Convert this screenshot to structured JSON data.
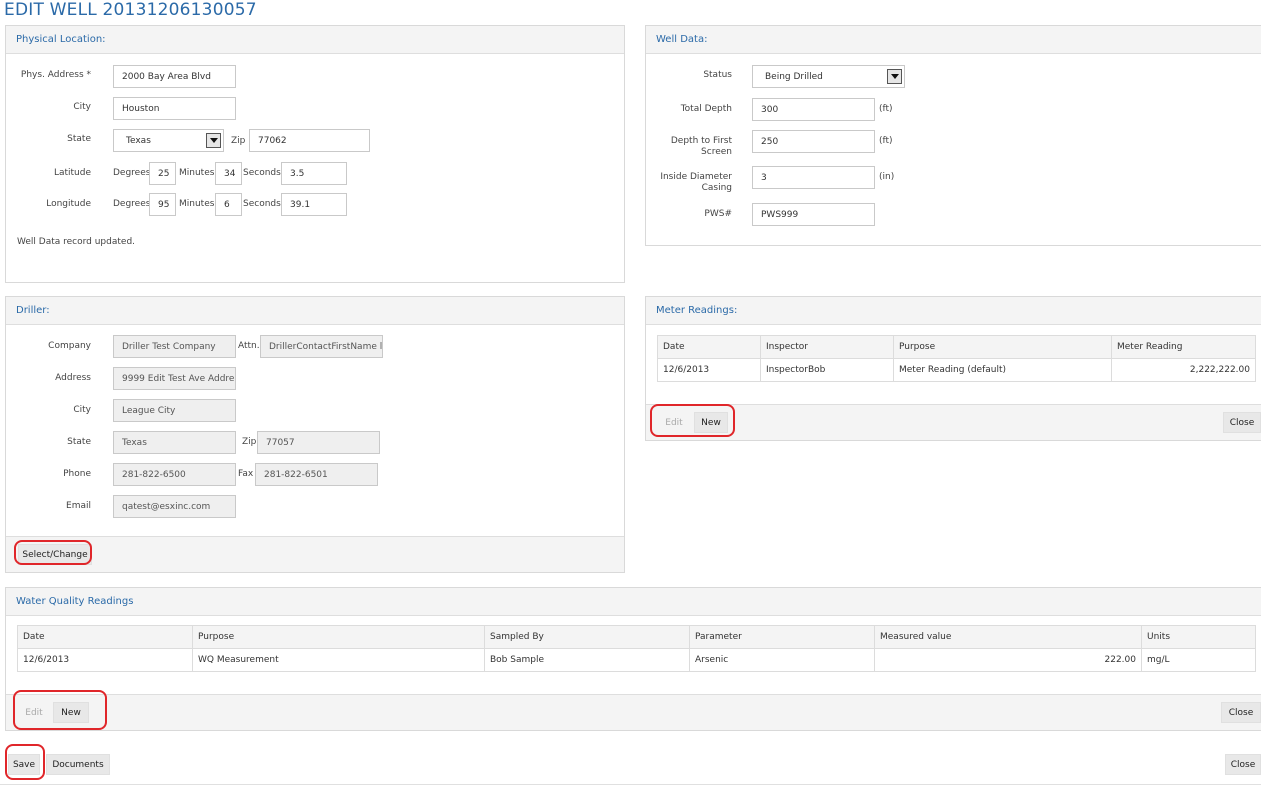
{
  "page": {
    "title": "EDIT WELL 20131206130057"
  },
  "physical_location": {
    "title": "Physical Location:",
    "address_label": "Phys. Address *",
    "address": "2000 Bay Area Blvd",
    "city_label": "City",
    "city": "Houston",
    "state_label": "State",
    "state": "Texas",
    "zip_label": "Zip",
    "zip": "77062",
    "latitude_label": "Latitude",
    "longitude_label": "Longitude",
    "degrees_label": "Degrees",
    "minutes_label": "Minutes",
    "seconds_label": "Seconds",
    "lat_degrees": "25",
    "lat_minutes": "34",
    "lat_seconds": "3.5",
    "lon_degrees": "95",
    "lon_minutes": "6",
    "lon_seconds": "39.1",
    "status_message": "Well Data record updated."
  },
  "well_data": {
    "title": "Well Data:",
    "status_label": "Status",
    "status": "Being Drilled",
    "total_depth_label": "Total Depth",
    "total_depth": "300",
    "total_depth_unit": "(ft)",
    "depth_first_screen_label_1": "Depth to First",
    "depth_first_screen_label_2": "Screen",
    "depth_first_screen": "250",
    "depth_first_screen_unit": "(ft)",
    "inside_diameter_label_1": "Inside Diameter",
    "inside_diameter_label_2": "Casing",
    "inside_diameter": "3",
    "inside_diameter_unit": "(in)",
    "pws_label": "PWS#",
    "pws": "PWS999"
  },
  "driller": {
    "title": "Driller:",
    "company_label": "Company",
    "company": "Driller Test Company",
    "attn_label": "Attn.",
    "attn": "DrillerContactFirstName l",
    "address_label": "Address",
    "address": "9999 Edit Test Ave Addre",
    "city_label": "City",
    "city": "League City",
    "state_label": "State",
    "state": "Texas",
    "zip_label": "Zip",
    "zip": "77057",
    "phone_label": "Phone",
    "phone": "281-822-6500",
    "fax_label": "Fax",
    "fax": "281-822-6501",
    "email_label": "Email",
    "email": "qatest@esxinc.com",
    "select_change_label": "Select/Change"
  },
  "meter_readings": {
    "title": "Meter Readings:",
    "columns": [
      "Date",
      "Inspector",
      "Purpose",
      "Meter Reading"
    ],
    "rows": [
      [
        "12/6/2013",
        "InspectorBob",
        "Meter Reading (default)",
        "2,222,222.00"
      ]
    ],
    "edit_label": "Edit",
    "new_label": "New",
    "close_label": "Close"
  },
  "water_quality": {
    "title": "Water Quality Readings",
    "columns": [
      "Date",
      "Purpose",
      "Sampled By",
      "Parameter",
      "Measured value",
      "Units"
    ],
    "rows": [
      [
        "12/6/2013",
        "WQ Measurement",
        "Bob Sample",
        "Arsenic",
        "222.00",
        "mg/L"
      ]
    ],
    "edit_label": "Edit",
    "new_label": "New",
    "close_label": "Close"
  },
  "footer": {
    "save_label": "Save",
    "documents_label": "Documents",
    "close_label": "Close"
  },
  "colors": {
    "accent": "#2b6aa8",
    "highlight": "#e0262a"
  }
}
